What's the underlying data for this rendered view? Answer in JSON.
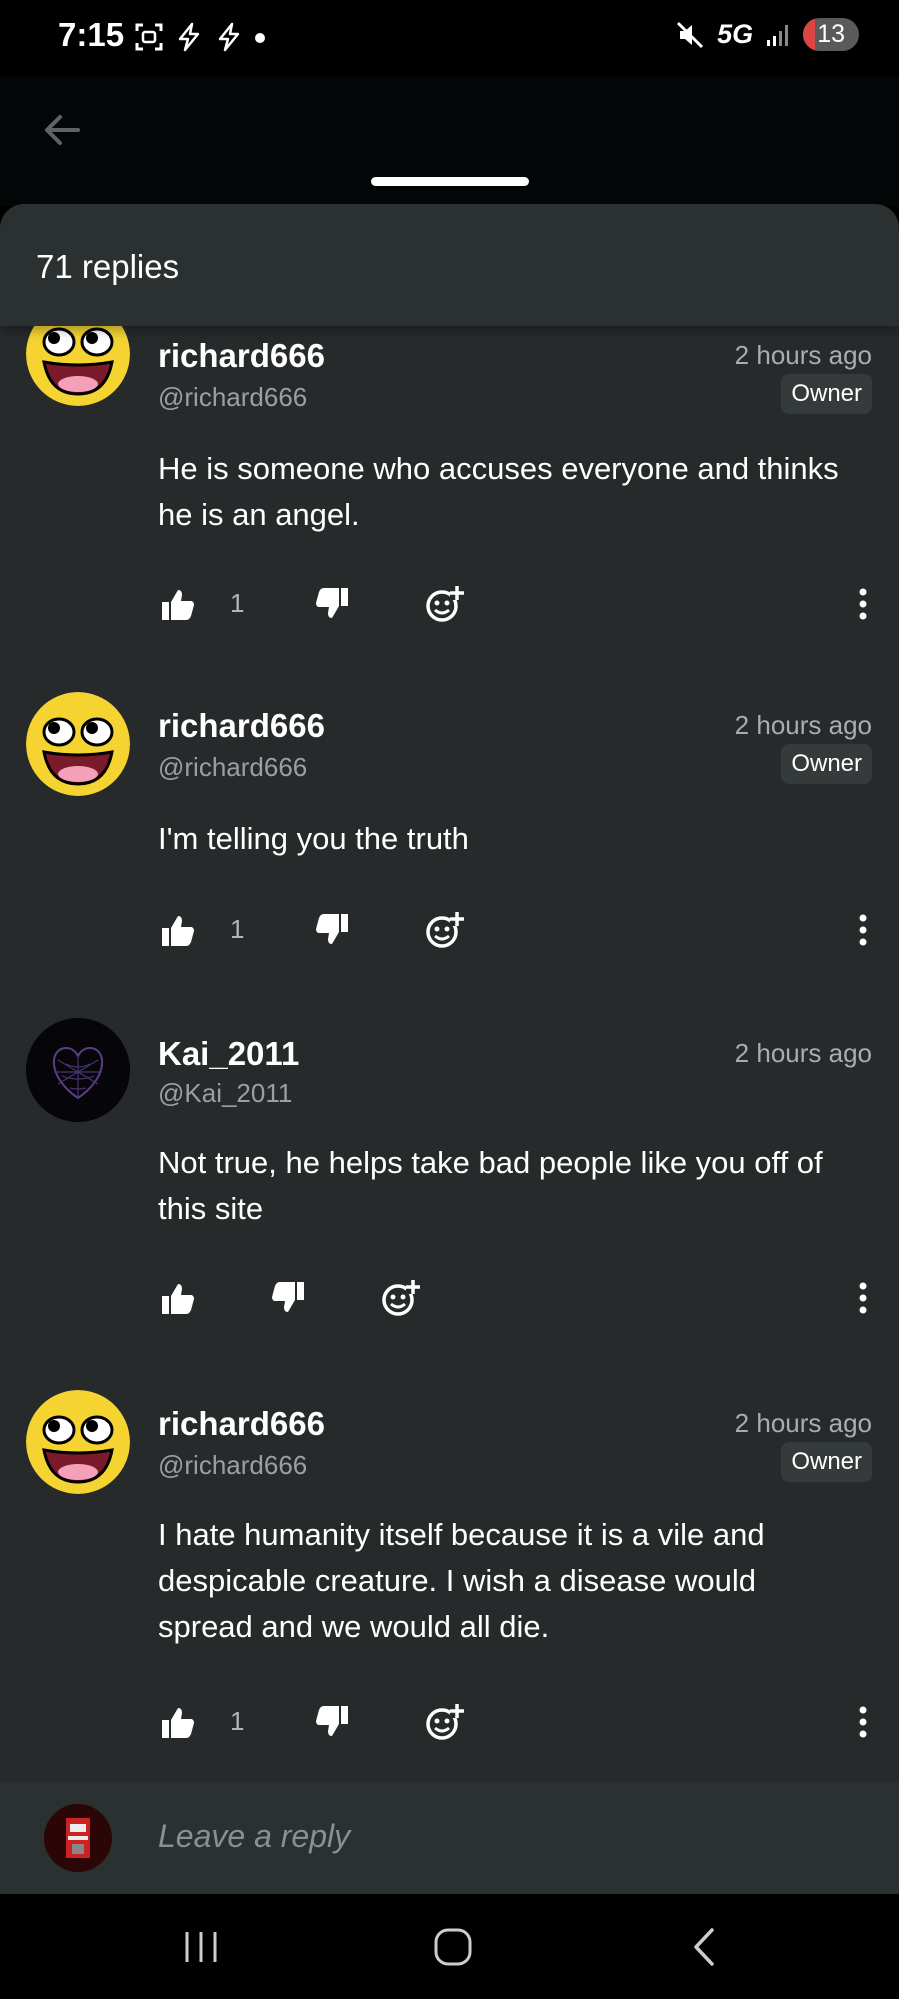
{
  "status_bar": {
    "time": "7:15",
    "network": "5G",
    "battery": "13"
  },
  "sheet": {
    "replies_count": "71 replies"
  },
  "comments": [
    {
      "username": "richard666",
      "handle": "@richard666",
      "time": "2 hours ago",
      "badge": "Owner",
      "text": "He is someone who accuses everyone and thinks he is an angel.",
      "likes": "1",
      "avatar": "awesome-face"
    },
    {
      "username": "richard666",
      "handle": "@richard666",
      "time": "2 hours ago",
      "badge": "Owner",
      "text": "I'm telling you the truth",
      "likes": "1",
      "avatar": "awesome-face"
    },
    {
      "username": "Kai_2011",
      "handle": "@Kai_2011",
      "time": "2 hours ago",
      "text": "Not true, he helps take bad people like you off of this site",
      "avatar": "spiderweb-heart"
    },
    {
      "username": "richard666",
      "handle": "@richard666",
      "time": "2 hours ago",
      "badge": "Owner",
      "text": "I hate humanity itself because it is a vile and despicable creature. I wish a disease would spread and we would all die.",
      "likes": "1",
      "avatar": "awesome-face"
    }
  ],
  "reply_bar": {
    "placeholder": "Leave a reply"
  },
  "colors": {
    "sheet_bg": "#262a2a",
    "header_bg": "#2b3030",
    "badge_bg": "#353a3a",
    "muted_text": "#9aa0a0"
  }
}
